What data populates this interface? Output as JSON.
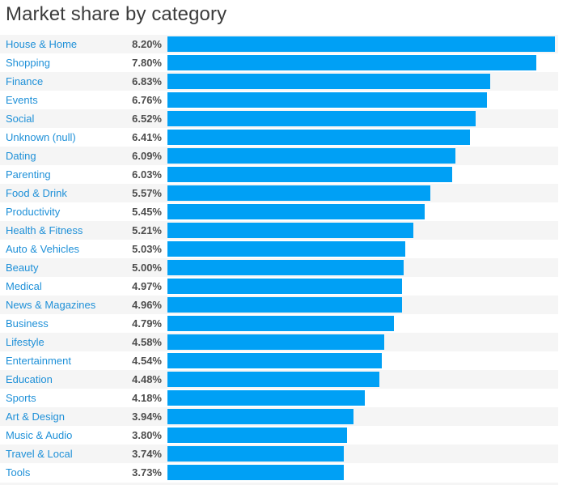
{
  "chart": {
    "title": "Market share by category",
    "colors": {
      "bar": "#00a0f5",
      "label": "#1e90d8",
      "value": "#4d4d4d",
      "title": "#3c3c3c",
      "stripe": "#f5f5f5",
      "background": "#ffffff"
    }
  },
  "chart_data": {
    "type": "bar",
    "orientation": "horizontal",
    "title": "Market share by category",
    "xlabel": "",
    "ylabel": "",
    "unit": "%",
    "xlim": [
      0,
      8.2
    ],
    "grid": false,
    "legend": null,
    "value_labels": true,
    "categories": [
      "House & Home",
      "Shopping",
      "Finance",
      "Events",
      "Social",
      "Unknown (null)",
      "Dating",
      "Parenting",
      "Food & Drink",
      "Productivity",
      "Health & Fitness",
      "Auto & Vehicles",
      "Beauty",
      "Medical",
      "News & Magazines",
      "Business",
      "Lifestyle",
      "Entertainment",
      "Education",
      "Sports",
      "Art & Design",
      "Music & Audio",
      "Travel & Local",
      "Tools"
    ],
    "values": [
      8.2,
      7.8,
      6.83,
      6.76,
      6.52,
      6.41,
      6.09,
      6.03,
      5.57,
      5.45,
      5.21,
      5.03,
      5.0,
      4.97,
      4.96,
      4.79,
      4.58,
      4.54,
      4.48,
      4.18,
      3.94,
      3.8,
      3.74,
      3.73
    ],
    "value_label_texts": [
      "8.20%",
      "7.80%",
      "6.83%",
      "6.76%",
      "6.52%",
      "6.41%",
      "6.09%",
      "6.03%",
      "5.57%",
      "5.45%",
      "5.21%",
      "5.03%",
      "5.00%",
      "4.97%",
      "4.96%",
      "4.79%",
      "4.58%",
      "4.54%",
      "4.48%",
      "4.18%",
      "3.94%",
      "3.80%",
      "3.74%",
      "3.73%"
    ]
  },
  "rows": [
    {
      "label": "House & Home",
      "value": "8.20%",
      "num": 8.2
    },
    {
      "label": "Shopping",
      "value": "7.80%",
      "num": 7.8
    },
    {
      "label": "Finance",
      "value": "6.83%",
      "num": 6.83
    },
    {
      "label": "Events",
      "value": "6.76%",
      "num": 6.76
    },
    {
      "label": "Social",
      "value": "6.52%",
      "num": 6.52
    },
    {
      "label": "Unknown (null)",
      "value": "6.41%",
      "num": 6.41
    },
    {
      "label": "Dating",
      "value": "6.09%",
      "num": 6.09
    },
    {
      "label": "Parenting",
      "value": "6.03%",
      "num": 6.03
    },
    {
      "label": "Food & Drink",
      "value": "5.57%",
      "num": 5.57
    },
    {
      "label": "Productivity",
      "value": "5.45%",
      "num": 5.45
    },
    {
      "label": "Health & Fitness",
      "value": "5.21%",
      "num": 5.21
    },
    {
      "label": "Auto & Vehicles",
      "value": "5.03%",
      "num": 5.03
    },
    {
      "label": "Beauty",
      "value": "5.00%",
      "num": 5.0
    },
    {
      "label": "Medical",
      "value": "4.97%",
      "num": 4.97
    },
    {
      "label": "News & Magazines",
      "value": "4.96%",
      "num": 4.96
    },
    {
      "label": "Business",
      "value": "4.79%",
      "num": 4.79
    },
    {
      "label": "Lifestyle",
      "value": "4.58%",
      "num": 4.58
    },
    {
      "label": "Entertainment",
      "value": "4.54%",
      "num": 4.54
    },
    {
      "label": "Education",
      "value": "4.48%",
      "num": 4.48
    },
    {
      "label": "Sports",
      "value": "4.18%",
      "num": 4.18
    },
    {
      "label": "Art & Design",
      "value": "3.94%",
      "num": 3.94
    },
    {
      "label": "Music & Audio",
      "value": "3.80%",
      "num": 3.8
    },
    {
      "label": "Travel & Local",
      "value": "3.74%",
      "num": 3.74
    },
    {
      "label": "Tools",
      "value": "3.73%",
      "num": 3.73
    }
  ]
}
